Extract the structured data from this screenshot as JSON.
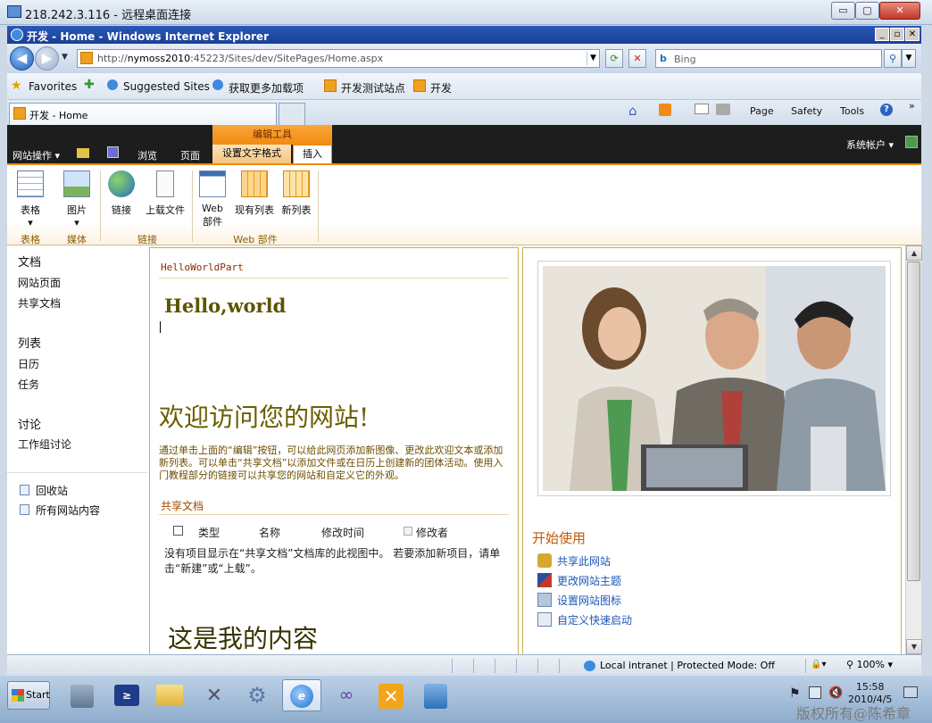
{
  "rdp": {
    "title": "218.242.3.116 - 远程桌面连接",
    "btn_min": "▭",
    "btn_max": "▢",
    "btn_close": "✕"
  },
  "ie": {
    "title": "开发 - Home - Windows Internet Explorer",
    "btn_min": "_",
    "btn_max": "▫",
    "btn_close": "✕"
  },
  "nav": {
    "url_prefix": "http://",
    "url_host": "nymoss2010",
    "url_path": ":45223/Sites/dev/SitePages/Home.aspx",
    "search_placeholder": "Bing",
    "back": "◀",
    "forward": "▶"
  },
  "favbar": {
    "favorites": "Favorites",
    "items": [
      "Suggested Sites",
      "获取更多加载项",
      "开发测试站点",
      "开发"
    ]
  },
  "tabs": {
    "active": "开发 - Home"
  },
  "commands": {
    "page": "Page",
    "safety": "Safety",
    "tools": "Tools"
  },
  "sp": {
    "site_actions": "网站操作",
    "browse": "浏览",
    "page": "页面",
    "editing_tools": "编辑工具",
    "format_text": "设置文字格式",
    "insert": "插入",
    "account": "系统帐户"
  },
  "ribbon": {
    "buttons": {
      "table": "表格",
      "picture": "图片",
      "link": "链接",
      "upload": "上载文件",
      "webpart_l1": "Web",
      "webpart_l2": "部件",
      "existing_list": "现有列表",
      "new_list": "新列表"
    },
    "groups": {
      "tables": "表格",
      "media": "媒体",
      "links": "链接",
      "webparts": "Web 部件"
    }
  },
  "leftnav": {
    "docs": "文档",
    "site_pages": "网站页面",
    "shared_docs": "共享文档",
    "lists": "列表",
    "calendar": "日历",
    "tasks": "任务",
    "discussions": "讨论",
    "team_discussion": "工作组讨论",
    "recycle": "回收站",
    "all_content": "所有网站内容"
  },
  "main": {
    "webpart_title": "HelloWorldPart",
    "hello": "Hello,world",
    "welcome": "欢迎访问您的网站!",
    "intro": "通过单击上面的“编辑”按钮，可以给此网页添加新图像、更改此欢迎文本或添加新列表。可以单击“共享文档”以添加文件或在日历上创建新的团体活动。使用入门教程部分的链接可以共享您的网站和自定义它的外观。",
    "shared_docs_title": "共享文档",
    "cols": {
      "type": "类型",
      "name": "名称",
      "modified": "修改时间",
      "modified_by": "修改者"
    },
    "empty": "没有项目显示在“共享文档”文档库的此视图中。 若要添加新项目，请单击“新建”或“上载”。",
    "my_content": "这是我的内容"
  },
  "right": {
    "getting_started": "开始使用",
    "items": [
      "共享此网站",
      "更改网站主题",
      "设置网站图标",
      "自定义快速启动"
    ]
  },
  "status": {
    "zone": "Local intranet | Protected Mode: Off",
    "zoom": "100%"
  },
  "taskbar": {
    "start": "Start",
    "time": "15:58",
    "date": "2010/4/5"
  },
  "watermark": "版权所有@陈希章",
  "colors": {
    "sp_orange": "#f28a10",
    "sp_dark": "#1d1d1d",
    "link_blue": "#1d57b4",
    "ie_blue": "#1a3f96"
  }
}
